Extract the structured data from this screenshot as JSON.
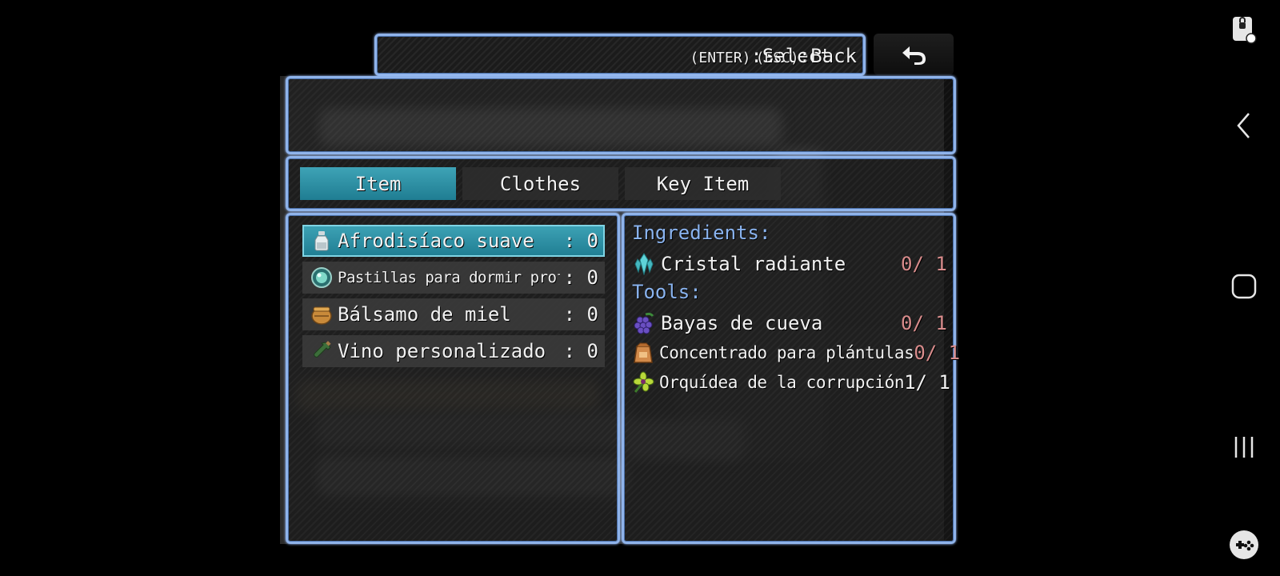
{
  "help": {
    "select": ":Select",
    "select_key": "(ENTER)",
    "back": ":Back",
    "back_key": "(ESC)"
  },
  "categories": [
    {
      "label": "Item",
      "active": true
    },
    {
      "label": "Clothes",
      "active": false
    },
    {
      "label": "Key Item",
      "active": false
    }
  ],
  "items": [
    {
      "name": "Afrodisíaco suave",
      "qty": ": 0",
      "icon": "potion-bottle-icon",
      "selected": true
    },
    {
      "name": "Pastillas para dormir profundamente",
      "qty": ": 0",
      "icon": "teal-orb-icon",
      "selected": false
    },
    {
      "name": "Bálsamo de miel",
      "qty": ": 0",
      "icon": "honey-pot-icon",
      "selected": false
    },
    {
      "name": "Vino personalizado",
      "qty": ": 0",
      "icon": "wine-bottle-icon",
      "selected": false
    }
  ],
  "recipe": {
    "ingredients_label": "Ingredients:",
    "ingredients": [
      {
        "name": "Cristal radiante",
        "count": "0/ 1",
        "icon": "crystal-icon",
        "enough": false
      }
    ],
    "tools_label": "Tools:",
    "tools": [
      {
        "name": "Bayas de cueva",
        "count": "0/ 1",
        "icon": "berries-icon",
        "enough": false
      },
      {
        "name": "Concentrado para plántulas",
        "count": "0/ 1",
        "icon": "fertilizer-bag-icon",
        "enough": false
      },
      {
        "name": "Orquídea de la corrupción",
        "count": "1/ 1",
        "icon": "orchid-icon",
        "enough": true
      }
    ]
  },
  "colors": {
    "frame": "#8fb3ea",
    "selected": "#2f93a8",
    "section": "#8ab4f0",
    "lacking": "#d98c8c"
  }
}
